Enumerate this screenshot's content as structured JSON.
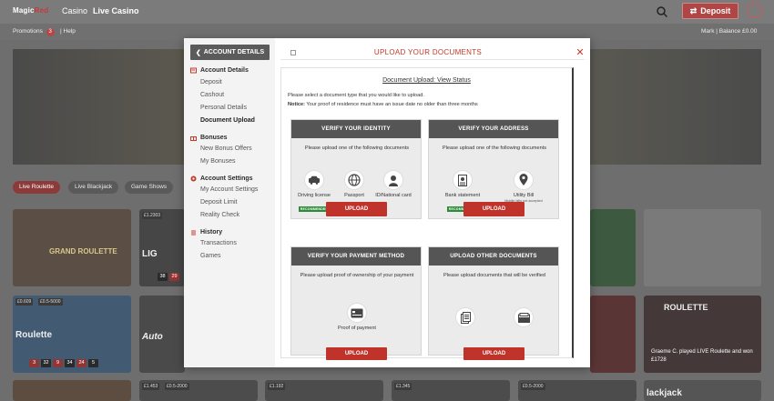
{
  "colors": {
    "accent": "#c0392b",
    "recommended": "#2e8b3a",
    "card_header": "#555555",
    "overlay": "#6e6e6e"
  },
  "topbar": {
    "logo_prefix": "Magic",
    "logo_suffix": "Red",
    "nav": [
      "Casino",
      "Live Casino"
    ],
    "deposit_label": "Deposit",
    "search_icon": "search-icon",
    "user_icon": "user-icon"
  },
  "subbar": {
    "promotions_label": "Promotions",
    "promotions_count": "3",
    "help_label": "Help",
    "account_info": "Mark  |  Balance £0.00"
  },
  "filters": [
    "Live Roulette",
    "Live Blackjack",
    "Game Shows"
  ],
  "tiles": {
    "grand_roulette": "GRAND ROULETTE",
    "roulette": "Roulette",
    "live_roulette": "ROULETTE",
    "auto": "Auto",
    "lightning": "LIG",
    "blackjack": "lackjack",
    "winner_text": "Graeme C. played LIVE Roulette and won £1728",
    "badge_a": "£1.2303",
    "badge_b": "£0.609",
    "badge_c": "£0.5-5000",
    "badge_d": "£1.453",
    "badge_e": "£0.5-2000",
    "badge_f": "£1.192",
    "badge_g": "£1.345",
    "badge_h": "£0.5-2000",
    "tile_nums_1": [
      "38",
      "29"
    ],
    "tile_nums_2": [
      "3",
      "32",
      "9",
      "34",
      "24",
      "5"
    ]
  },
  "modal": {
    "back_label": "ACCOUNT DETAILS",
    "title": "UPLOAD YOUR DOCUMENTS",
    "close_label": "✕",
    "sidebar": {
      "sections": [
        {
          "heading": "Account Details",
          "items": [
            "Deposit",
            "Cashout",
            "Personal Details",
            "Document Upload"
          ]
        },
        {
          "heading": "Bonuses",
          "items": [
            "New Bonus Offers",
            "My Bonuses"
          ]
        },
        {
          "heading": "Account Settings",
          "items": [
            "My Account Settings",
            "Deposit Limit",
            "Reality Check"
          ]
        },
        {
          "heading": "History",
          "items": [
            "Transactions",
            "Games"
          ]
        }
      ],
      "active_item": "Document Upload"
    },
    "status_link": "Document Upload: View Status",
    "description": "Please select a document type that you would like to upload.",
    "notice_bold": "Notice:",
    "notice_text": " Your proof of residence must have an issue date no older than three months",
    "cards": {
      "identity": {
        "heading": "VERIFY YOUR IDENTITY",
        "desc": "Please upload one of the following documents",
        "options": [
          "Driving license",
          "Passport",
          "ID/National card"
        ],
        "recommended": "RECOMMENDED",
        "button": "UPLOAD"
      },
      "address": {
        "heading": "VERIFY YOUR ADDRESS",
        "desc": "Please upload one of the following documents",
        "options": [
          "Bank statement",
          "Utility Bill"
        ],
        "recommended": "RECOMMENDED",
        "note": "Mobile bills not accepted",
        "button": "UPLOAD"
      },
      "payment": {
        "heading": "VERIFY YOUR PAYMENT METHOD",
        "desc": "Please upload proof of ownership of your payment",
        "options": [
          "Proof of payment"
        ],
        "button": "UPLOAD"
      },
      "other": {
        "heading": "UPLOAD OTHER DOCUMENTS",
        "desc": "Please upload documents that will be verified",
        "button": "UPLOAD"
      }
    }
  }
}
